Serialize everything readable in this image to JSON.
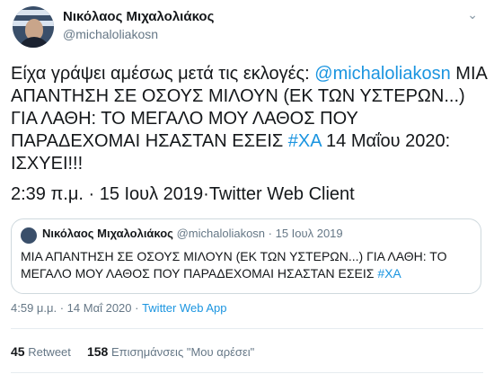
{
  "author": {
    "name": "Νικόλαος Μιχαλολιάκος",
    "handle": "@michaloliakosn"
  },
  "tweet": {
    "text_1": "Είχα γράψει αμέσως μετά τις εκλογές: ",
    "mention": "@michaloliakosn",
    "text_2": " ΜΙΑ ΑΠΑΝΤΗΣΗ ΣΕ ΟΣΟΥΣ ΜΙΛΟΥΝ (ΕΚ ΤΩΝ ΥΣΤΕΡΩΝ...) ΓΙΑ ΛΑΘΗ: ΤΟ ΜΕΓΑΛΟ ΜΟΥ ΛΑΘΟΣ ΠΟΥ ΠΑΡΑΔΕΧΟΜΑΙ ΗΣΑΣΤΑΝ ΕΣΕΙΣ ",
    "hashtag": "#ΧΑ",
    "text_3": " 14 Μαΐου 2020: ΙΣΧΥΕΙ!!!",
    "meta": "2:39 π.μ. · 15 Ιουλ 2019·Twitter Web Client"
  },
  "quoted": {
    "name": "Νικόλαος Μιχαλολιάκος",
    "handle_date": "@michaloliakosn · 15 Ιουλ 2019",
    "text": "ΜΙΑ ΑΠΑΝΤΗΣΗ ΣΕ ΟΣΟΥΣ ΜΙΛΟΥΝ (ΕΚ ΤΩΝ ΥΣΤΕΡΩΝ...) ΓΙΑ ΛΑΘΗ: ΤΟ ΜΕΓΑΛΟ ΜΟΥ ΛΑΘΟΣ ΠΟΥ ΠΑΡΑΔΕΧΟΜΑΙ ΗΣΑΣΤΑΝ ΕΣΕΙΣ ",
    "hashtag": "#ΧΑ"
  },
  "info": {
    "time": "4:59 μ.μ. · 14 Μαΐ 2020 · ",
    "app": "Twitter Web App"
  },
  "stats": {
    "retweets": "45",
    "retweet_label": "Retweet",
    "likes": "158",
    "likes_label": "Επισημάνσεις \"Μου αρέσει\""
  },
  "icons": {
    "caret": "chevron-down-icon"
  },
  "colors": {
    "link": "#1b95e0",
    "muted": "#657786"
  }
}
